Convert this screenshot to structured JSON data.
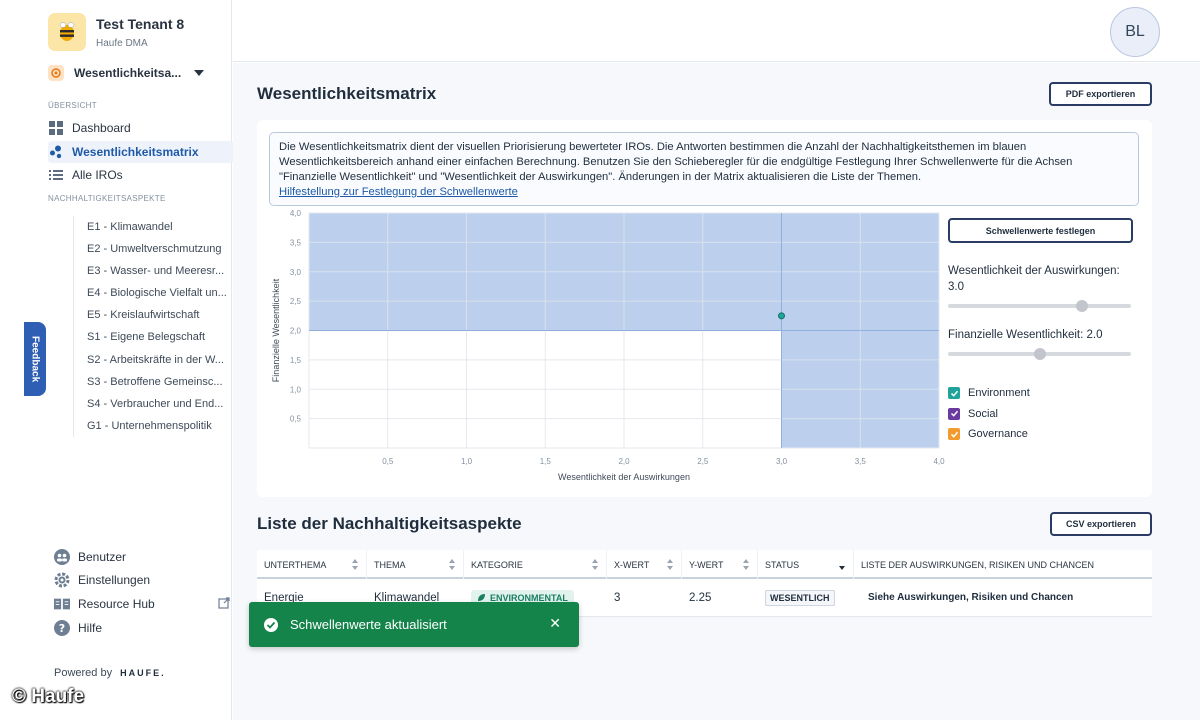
{
  "tenant": {
    "name": "Test Tenant 8",
    "subtitle": "Haufe DMA"
  },
  "selector": {
    "label": "Wesentlichkeitsa..."
  },
  "sidebar": {
    "overview_label": "ÜBERSICHT",
    "nav": [
      {
        "label": "Dashboard",
        "icon": "dashboard-icon"
      },
      {
        "label": "Wesentlichkeitsmatrix",
        "icon": "matrix-icon",
        "active": true
      },
      {
        "label": "Alle IROs",
        "icon": "list-icon"
      }
    ],
    "aspects_label": "NACHHALTIGKEITSASPEKTE",
    "aspects": [
      "E1 - Klimawandel",
      "E2 - Umweltverschmutzung",
      "E3 - Wasser- und Meeresr...",
      "E4 - Biologische Vielfalt un...",
      "E5 - Kreislaufwirtschaft",
      "S1 - Eigene Belegschaft",
      "S2 - Arbeitskräfte in der W...",
      "S3 - Betroffene Gemeinsc...",
      "S4 - Verbraucher und End...",
      "G1 - Unternehmenspolitik"
    ],
    "bottom": [
      {
        "label": "Benutzer",
        "icon": "users-icon"
      },
      {
        "label": "Einstellungen",
        "icon": "gear-icon"
      },
      {
        "label": "Resource Hub",
        "icon": "book-icon",
        "external": true
      },
      {
        "label": "Hilfe",
        "icon": "help-icon"
      }
    ],
    "powered_by": "Powered by",
    "powered_brand": "HAUFE."
  },
  "feedback": "Feedback",
  "user": {
    "initials": "BL"
  },
  "page": {
    "title": "Wesentlichkeitsmatrix",
    "pdf_export": "PDF exportieren",
    "info_text": "Die Wesentlichkeitsmatrix dient der visuellen Priorisierung bewerteter IROs. Die Antworten bestimmen die Anzahl der Nachhaltigkeitsthemen im blauen Wesentlichkeitsbereich anhand einer einfachen Berechnung. Benutzen Sie den Schieberegler für die endgültige Festlegung Ihrer Schwellenwerte für die Achsen \"Finanzielle Wesentlichkeit\" und \"Wesentlichkeit der Auswirkungen\". Änderungen in der Matrix aktualisieren die Liste der Themen.",
    "info_link": "Hilfestellung zur Festlegung der Schwellenwerte"
  },
  "chart_data": {
    "type": "scatter",
    "xlabel": "Wesentlichkeit der Auswirkungen",
    "ylabel": "Finanzielle Wesentlichkeit",
    "xlim": [
      0,
      4
    ],
    "ylim": [
      0,
      4
    ],
    "x_ticks": [
      "0,5",
      "1,0",
      "1,5",
      "2,0",
      "2,5",
      "3,0",
      "3,5",
      "4,0"
    ],
    "y_ticks": [
      "4,0",
      "3,5",
      "3,0",
      "2,5",
      "2,0",
      "1,5",
      "1,0",
      "0,5"
    ],
    "threshold_x": 3.0,
    "threshold_y": 2.0,
    "highlight_color": "#bcd0ee",
    "points": [
      {
        "x": 3.0,
        "y": 2.25,
        "color": "#1fa39a"
      }
    ]
  },
  "controls": {
    "set_thresholds": "Schwellenwerte festlegen",
    "impact_label": "Wesentlichkeit der Auswirkungen: 3.0",
    "impact_value": 3.0,
    "financial_label": "Finanzielle Wesentlichkeit: 2.0",
    "financial_value": 2.0,
    "slider_max": 4.0,
    "legend": [
      {
        "label": "Environment",
        "color": "#1fa39a"
      },
      {
        "label": "Social",
        "color": "#6b3aa0"
      },
      {
        "label": "Governance",
        "color": "#f29a2e"
      }
    ]
  },
  "list": {
    "title": "Liste der Nachhaltigkeitsaspekte",
    "csv_export": "CSV exportieren",
    "columns": [
      "UNTERTHEMA",
      "THEMA",
      "KATEGORIE",
      "X-WERT",
      "Y-WERT",
      "STATUS",
      "LISTE DER AUSWIRKUNGEN, RISIKEN UND CHANCEN"
    ],
    "rows": [
      {
        "subtopic": "Energie",
        "topic": "Klimawandel",
        "category": "ENVIRONMENTAL",
        "x": "3",
        "y": "2.25",
        "status": "WESENTLICH",
        "link": "Siehe Auswirkungen, Risiken und Chancen"
      }
    ]
  },
  "toast": {
    "message": "Schwellenwerte aktualisiert"
  },
  "watermark": "© Haufe"
}
